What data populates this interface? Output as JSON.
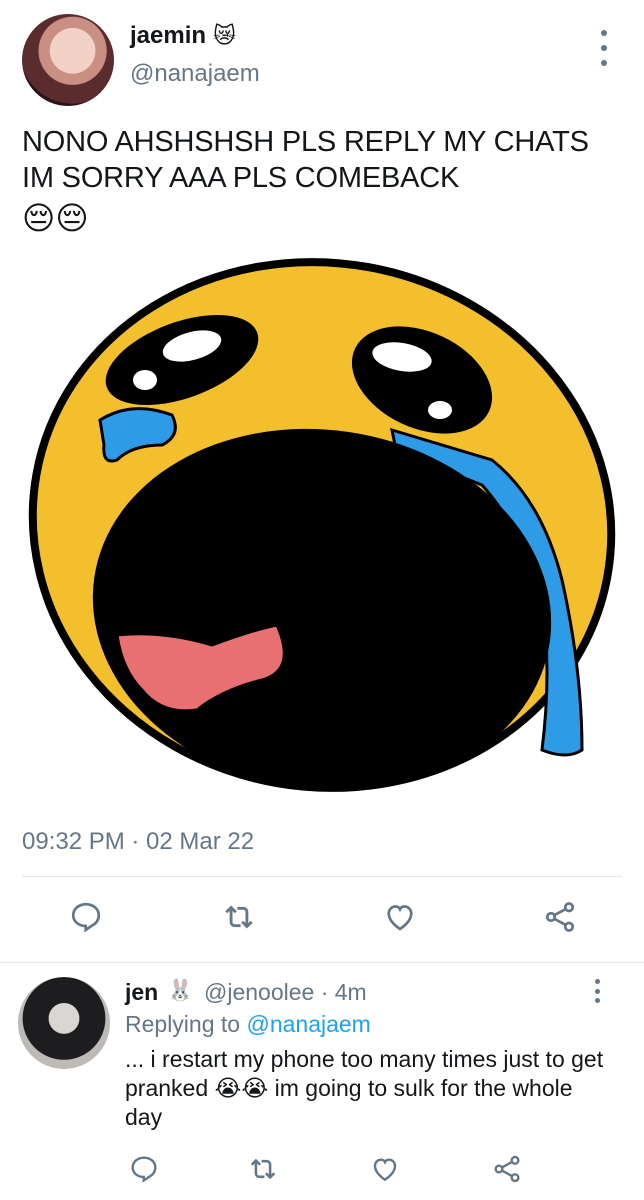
{
  "tweet": {
    "author_name": "jaemin",
    "author_emoji": "😿",
    "author_handle": "@nanajaem",
    "text": "NONO AHSHSHSH PLS REPLY MY CHATS IM SORRY AAA PLS COMEBACK",
    "text_emoji": "😔😔",
    "timestamp": "09:32 PM · 02 Mar 22"
  },
  "reply": {
    "author_name": "jen",
    "author_emoji": "🐰",
    "handle_time": "@jenoolee · 4m",
    "replying_prefix": "Replying to ",
    "replying_to": "@nanajaem",
    "text": "... i restart my phone too many times just to get pranked 😭😭 im going to sulk for the whole day"
  },
  "colors": {
    "text": "#14171a",
    "muted": "#657786",
    "link": "#1da1f2",
    "divider": "#e1e8ed",
    "emoji_yellow": "#f4bf2d",
    "tear_blue": "#2e9be6",
    "tongue_pink": "#e87070"
  },
  "icons": {
    "reply": "speech-bubble-icon",
    "retweet": "retweet-icon",
    "like": "heart-icon",
    "share": "share-icon",
    "more": "vertical-dots-icon"
  }
}
